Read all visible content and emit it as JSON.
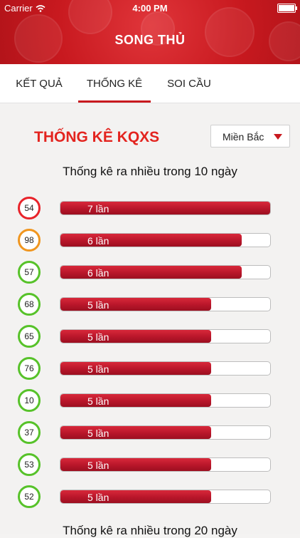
{
  "status_bar": {
    "carrier": "Carrier",
    "time": "4:00 PM"
  },
  "header": {
    "title": "SONG THỦ"
  },
  "tabs": [
    {
      "label": "KẾT QUẢ",
      "active": false
    },
    {
      "label": "THỐNG KÊ",
      "active": true
    },
    {
      "label": "SOI CẦU",
      "active": false
    }
  ],
  "main": {
    "title": "THỐNG KÊ KQXS",
    "region": "Miền Bắc",
    "section1": "Thống kê ra nhiều trong 10 ngày",
    "section2": "Thống kê ra nhiều trong 20 ngày",
    "max_count": 7,
    "rows": [
      {
        "number": "54",
        "count": 7,
        "label": "7 lần",
        "ring": "#e8232a"
      },
      {
        "number": "98",
        "count": 6,
        "label": "6 lần",
        "ring": "#f0961f"
      },
      {
        "number": "57",
        "count": 6,
        "label": "6 lần",
        "ring": "#57c22a"
      },
      {
        "number": "68",
        "count": 5,
        "label": "5 lần",
        "ring": "#57c22a"
      },
      {
        "number": "65",
        "count": 5,
        "label": "5 lần",
        "ring": "#57c22a"
      },
      {
        "number": "76",
        "count": 5,
        "label": "5 lần",
        "ring": "#57c22a"
      },
      {
        "number": "10",
        "count": 5,
        "label": "5 lần",
        "ring": "#57c22a"
      },
      {
        "number": "37",
        "count": 5,
        "label": "5 lần",
        "ring": "#57c22a"
      },
      {
        "number": "53",
        "count": 5,
        "label": "5 lần",
        "ring": "#57c22a"
      },
      {
        "number": "52",
        "count": 5,
        "label": "5 lần",
        "ring": "#57c22a"
      }
    ]
  }
}
